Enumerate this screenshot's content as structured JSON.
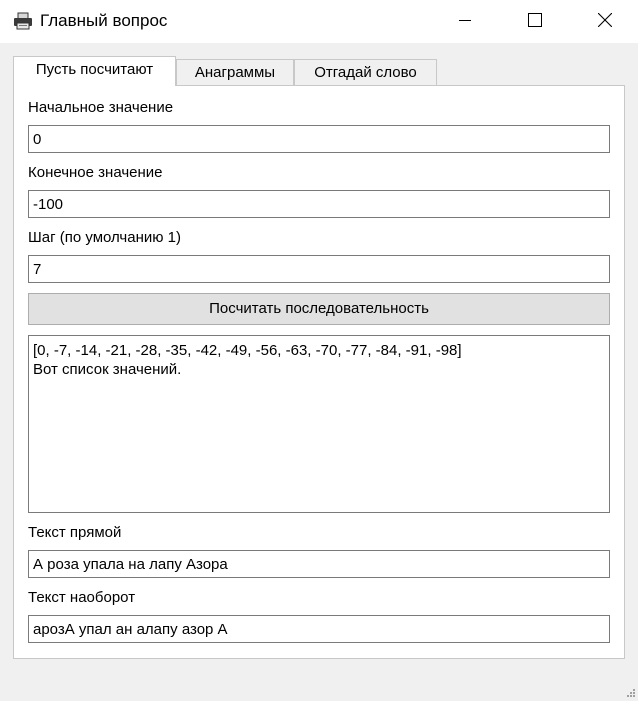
{
  "window": {
    "title": "Главный вопрос",
    "app_icon": "printer-icon",
    "controls": [
      "minimize-icon",
      "maximize-icon",
      "close-icon"
    ]
  },
  "tabs": [
    {
      "label": "Пусть посчитают",
      "active": true
    },
    {
      "label": "Анаграммы",
      "active": false
    },
    {
      "label": "Отгадай слово",
      "active": false
    }
  ],
  "sequence": {
    "start_label": "Начальное значение",
    "start_value": "0",
    "end_label": "Конечное значение",
    "end_value": "-100",
    "step_label": "Шаг (по умолчанию 1)",
    "step_value": "7",
    "button_label": "Посчитать последовательность",
    "output_line1": "[0, -7, -14, -21, -28, -35, -42, -49, -56, -63, -70, -77, -84, -91, -98]",
    "output_line2": "Вот список значений."
  },
  "reverse": {
    "direct_label": "Текст прямой",
    "direct_value": "А роза упала на лапу Азора",
    "reversed_label": "Текст наоборот",
    "reversed_value": "арозА упал ан алапу азор А"
  },
  "colors": {
    "titlebar_bg": "#ffffff",
    "window_bg": "#f0f0f0",
    "button_bg": "#e1e1e1",
    "field_border": "#7a7a7a"
  }
}
